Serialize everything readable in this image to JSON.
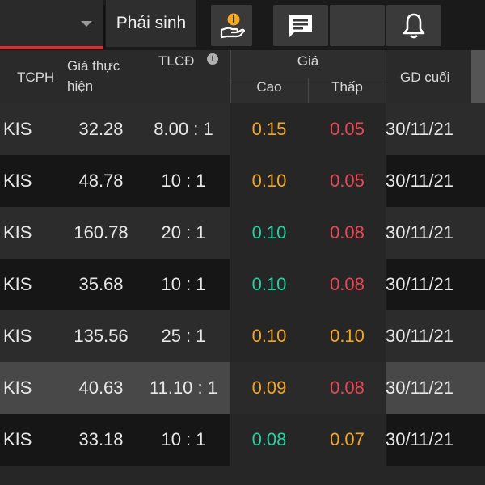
{
  "topbar": {
    "tab_label": "Phái sinh"
  },
  "header": {
    "tcph": "TCPH",
    "gia_thuc_hien_line1": "Giá thực",
    "gia_thuc_hien_line2": "hiện",
    "tlcd": "TLCĐ",
    "gia": "Giá",
    "cao": "Cao",
    "thap": "Thấp",
    "gd_cuoi": "GD cuối",
    "info_icon": "i"
  },
  "colors": {
    "orange": "#f5a623",
    "red": "#ec4654",
    "green": "#22d3a0",
    "accent_red": "#d9302f"
  },
  "rows": [
    {
      "tcph": "KIS",
      "gia": "32.28",
      "tlcd": "8.00 : 1",
      "cao": "0.15",
      "cao_color": "orange",
      "thap": "0.05",
      "thap_color": "red",
      "gd": "30/11/21",
      "bg": "#2c2c2c"
    },
    {
      "tcph": "KIS",
      "gia": "48.78",
      "tlcd": "10 : 1",
      "cao": "0.10",
      "cao_color": "orange",
      "thap": "0.05",
      "thap_color": "red",
      "gd": "30/11/21",
      "bg": "#161616"
    },
    {
      "tcph": "KIS",
      "gia": "160.78",
      "tlcd": "20 : 1",
      "cao": "0.10",
      "cao_color": "green",
      "thap": "0.08",
      "thap_color": "red",
      "gd": "30/11/21",
      "bg": "#2c2c2c"
    },
    {
      "tcph": "KIS",
      "gia": "35.68",
      "tlcd": "10 : 1",
      "cao": "0.10",
      "cao_color": "green",
      "thap": "0.08",
      "thap_color": "red",
      "gd": "30/11/21",
      "bg": "#161616"
    },
    {
      "tcph": "KIS",
      "gia": "135.56",
      "tlcd": "25 : 1",
      "cao": "0.10",
      "cao_color": "orange",
      "thap": "0.10",
      "thap_color": "orange",
      "gd": "30/11/21",
      "bg": "#2c2c2c"
    },
    {
      "tcph": "KIS",
      "gia": "40.63",
      "tlcd": "11.10 : 1",
      "cao": "0.09",
      "cao_color": "orange",
      "thap": "0.08",
      "thap_color": "red",
      "gd": "30/11/21",
      "bg": "#484848"
    },
    {
      "tcph": "KIS",
      "gia": "33.18",
      "tlcd": "10 : 1",
      "cao": "0.08",
      "cao_color": "green",
      "thap": "0.07",
      "thap_color": "orange",
      "gd": "30/11/21",
      "bg": "#161616"
    }
  ],
  "icons": [
    "chevron-down-icon",
    "hand-coin-icon",
    "chat-icon",
    "bell-icon",
    "info-icon"
  ]
}
